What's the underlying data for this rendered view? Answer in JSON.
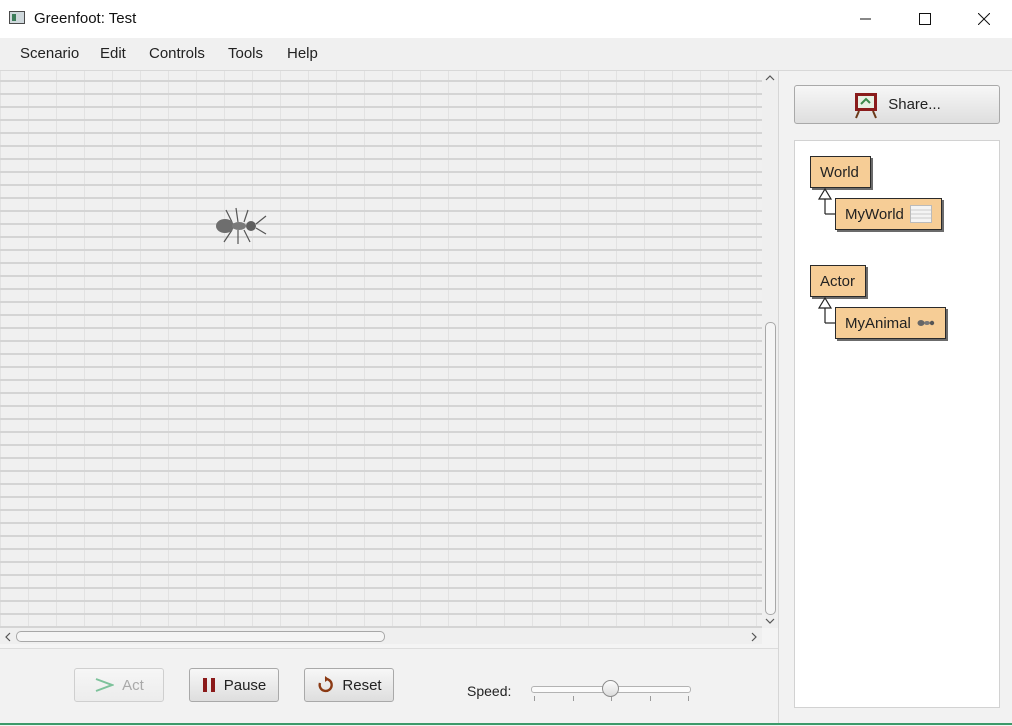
{
  "window": {
    "title": "Greenfoot: Test"
  },
  "menu": [
    "Scenario",
    "Edit",
    "Controls",
    "Tools",
    "Help"
  ],
  "controls": {
    "act_label": "Act",
    "pause_label": "Pause",
    "reset_label": "Reset",
    "speed_label": "Speed:",
    "speed_value": 0.5
  },
  "share": {
    "label": "Share..."
  },
  "classes": {
    "world": {
      "name": "World",
      "subclass": "MyWorld"
    },
    "actor": {
      "name": "Actor",
      "subclass": "MyAnimal"
    }
  },
  "colors": {
    "class_box": "#f6cd96",
    "act_icon": "#7dc29b",
    "pause_icon": "#8b1a1a",
    "reset_icon": "#8b3a14"
  }
}
